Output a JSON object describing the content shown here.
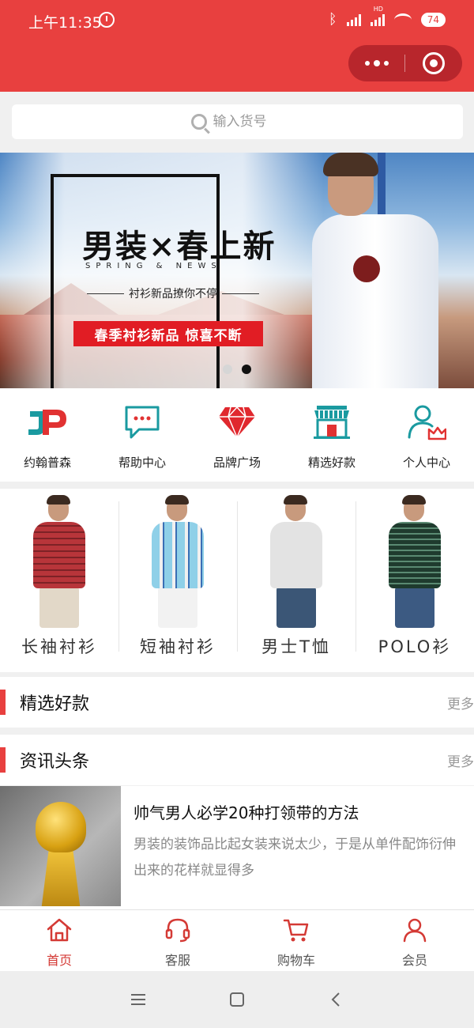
{
  "status_bar": {
    "time": "上午11:35",
    "battery": "74",
    "network_badge": "HD"
  },
  "search": {
    "placeholder": "输入货号"
  },
  "banner": {
    "title": "男装×春上新",
    "subtitle": "SPRING & NEWS",
    "tagline": "衬衫新品撩你不停",
    "promo": "春季衬衫新品 惊喜不断"
  },
  "nav": [
    {
      "label": "约翰普森",
      "icon": "jp-logo-icon"
    },
    {
      "label": "帮助中心",
      "icon": "chat-bubble-icon"
    },
    {
      "label": "品牌广场",
      "icon": "diamond-icon"
    },
    {
      "label": "精选好款",
      "icon": "storefront-icon"
    },
    {
      "label": "个人中心",
      "icon": "user-crown-icon"
    }
  ],
  "categories": [
    {
      "label": "长袖衬衫",
      "shirt_color": "#b8353a",
      "pants_color": "#e2d8c8"
    },
    {
      "label": "短袖衬衫",
      "shirt_color": "#8fd0e8",
      "pants_color": "#f2f2f2"
    },
    {
      "label": "男士T恤",
      "shirt_color": "#e3e3e3",
      "pants_color": "#3b5676"
    },
    {
      "label": "POLO衫",
      "shirt_color": "#1f3b2e",
      "pants_color": "#3c5a82"
    }
  ],
  "sections": {
    "featured": {
      "title": "精选好款",
      "more": "更多"
    },
    "news": {
      "title": "资讯头条",
      "more": "更多"
    }
  },
  "news": {
    "title": "帅气男人必学20种打领带的方法",
    "description": "男装的装饰品比起女装来说太少，于是从单件配饰衍伸出来的花样就显得多"
  },
  "tabbar": [
    {
      "label": "首页",
      "icon": "home-icon",
      "active": true
    },
    {
      "label": "客服",
      "icon": "headset-icon",
      "active": false
    },
    {
      "label": "购物车",
      "icon": "cart-icon",
      "active": false
    },
    {
      "label": "会员",
      "icon": "user-icon",
      "active": false
    }
  ],
  "colors": {
    "brand": "#e8403f",
    "accent_teal": "#1a9aa0",
    "accent_red": "#e13232"
  }
}
